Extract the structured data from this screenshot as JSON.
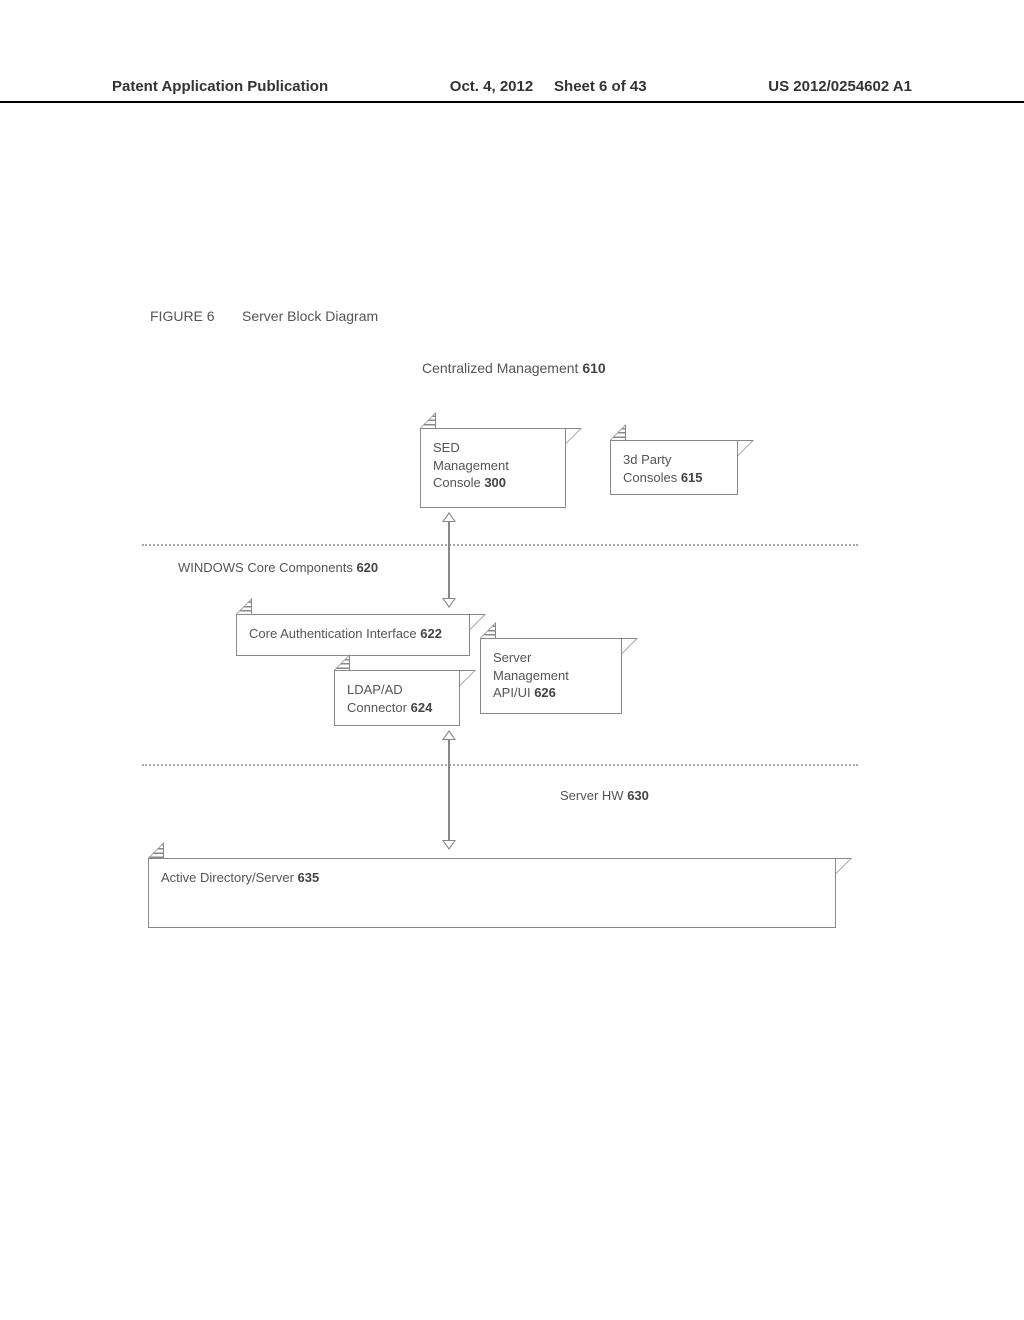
{
  "header": {
    "left": "Patent Application Publication",
    "mid_date": "Oct. 4, 2012",
    "mid_sheet": "Sheet 6 of 43",
    "right": "US 2012/0254602 A1"
  },
  "figure": {
    "label": "FIGURE 6",
    "title": "Server Block Diagram",
    "section_title": "Centralized Management",
    "section_ref": "610"
  },
  "boxes": {
    "sed": {
      "line1": "SED",
      "line2": "Management",
      "line3": "Console",
      "ref": "300"
    },
    "third_party": {
      "line1": "3d Party",
      "line2": "Consoles",
      "ref": "615"
    },
    "core_auth": {
      "text": "Core Authentication Interface",
      "ref": "622"
    },
    "ldap": {
      "line1": "LDAP/AD",
      "line2": "Connector",
      "ref": "624"
    },
    "server_mgmt": {
      "line1": "Server",
      "line2": "Management",
      "line3": "API/UI",
      "ref": "626"
    },
    "active_dir": {
      "text": "Active Directory/Server",
      "ref": "635"
    }
  },
  "layers": {
    "windows": {
      "text": "WINDOWS Core Components",
      "ref": "620"
    },
    "server_hw": {
      "text": "Server HW",
      "ref": "630"
    }
  }
}
